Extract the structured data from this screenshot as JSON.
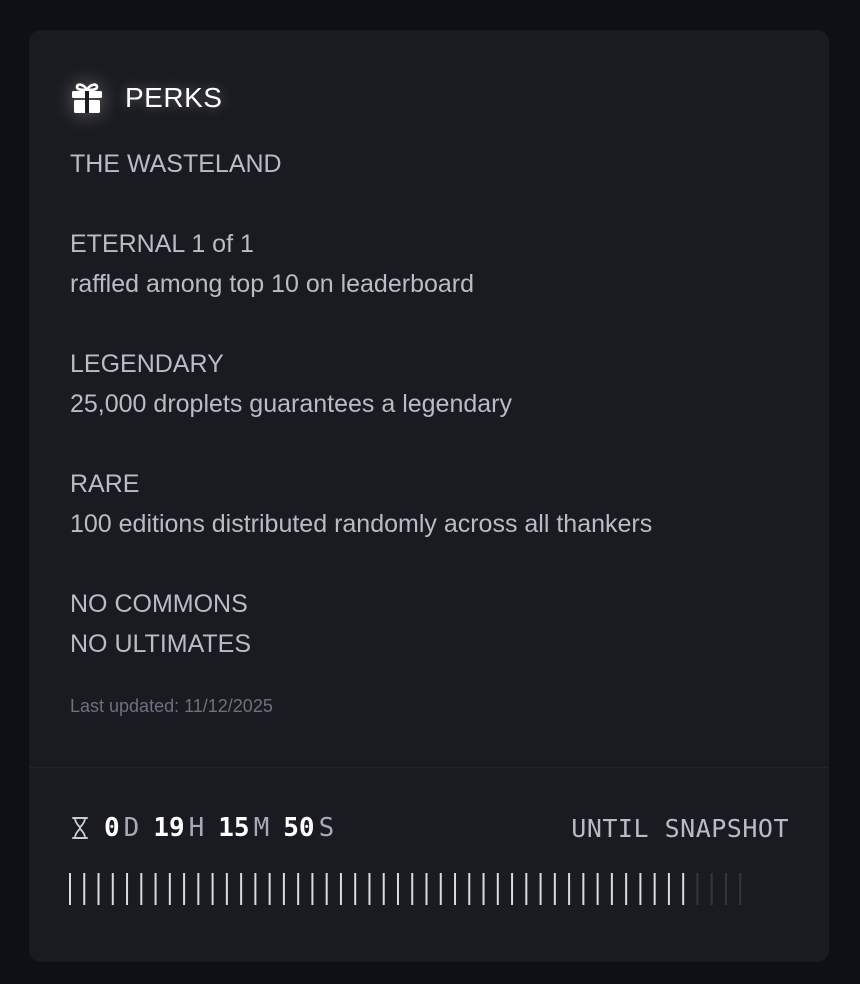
{
  "perks": {
    "title": "PERKS",
    "icon": "gift-icon",
    "lines": [
      "THE WASTELAND",
      "",
      "ETERNAL 1 of 1",
      "raffled among top 10 on leaderboard",
      "",
      "LEGENDARY",
      "25,000 droplets guarantees a legendary",
      "",
      "RARE",
      "100 editions distributed randomly across all thankers",
      "",
      "NO COMMONS",
      "NO ULTIMATES"
    ],
    "last_updated": "Last updated: 11/12/2025"
  },
  "countdown": {
    "icon": "hourglass-icon",
    "days": "0",
    "days_unit": "D",
    "hours": "19",
    "hours_unit": "H",
    "minutes": "15",
    "minutes_unit": "M",
    "seconds": "50",
    "seconds_unit": "S",
    "label": "UNTIL SNAPSHOT",
    "progress": {
      "total_ticks": 48,
      "elapsed_ticks": 44,
      "fraction_elapsed": 0.917
    }
  },
  "colors": {
    "background": "#0e1015",
    "card": "#1a1b20",
    "text": "#b9bcc7",
    "muted": "#6d717f",
    "tick_active": "#d8dbe3",
    "tick_inactive": "#33363e"
  }
}
